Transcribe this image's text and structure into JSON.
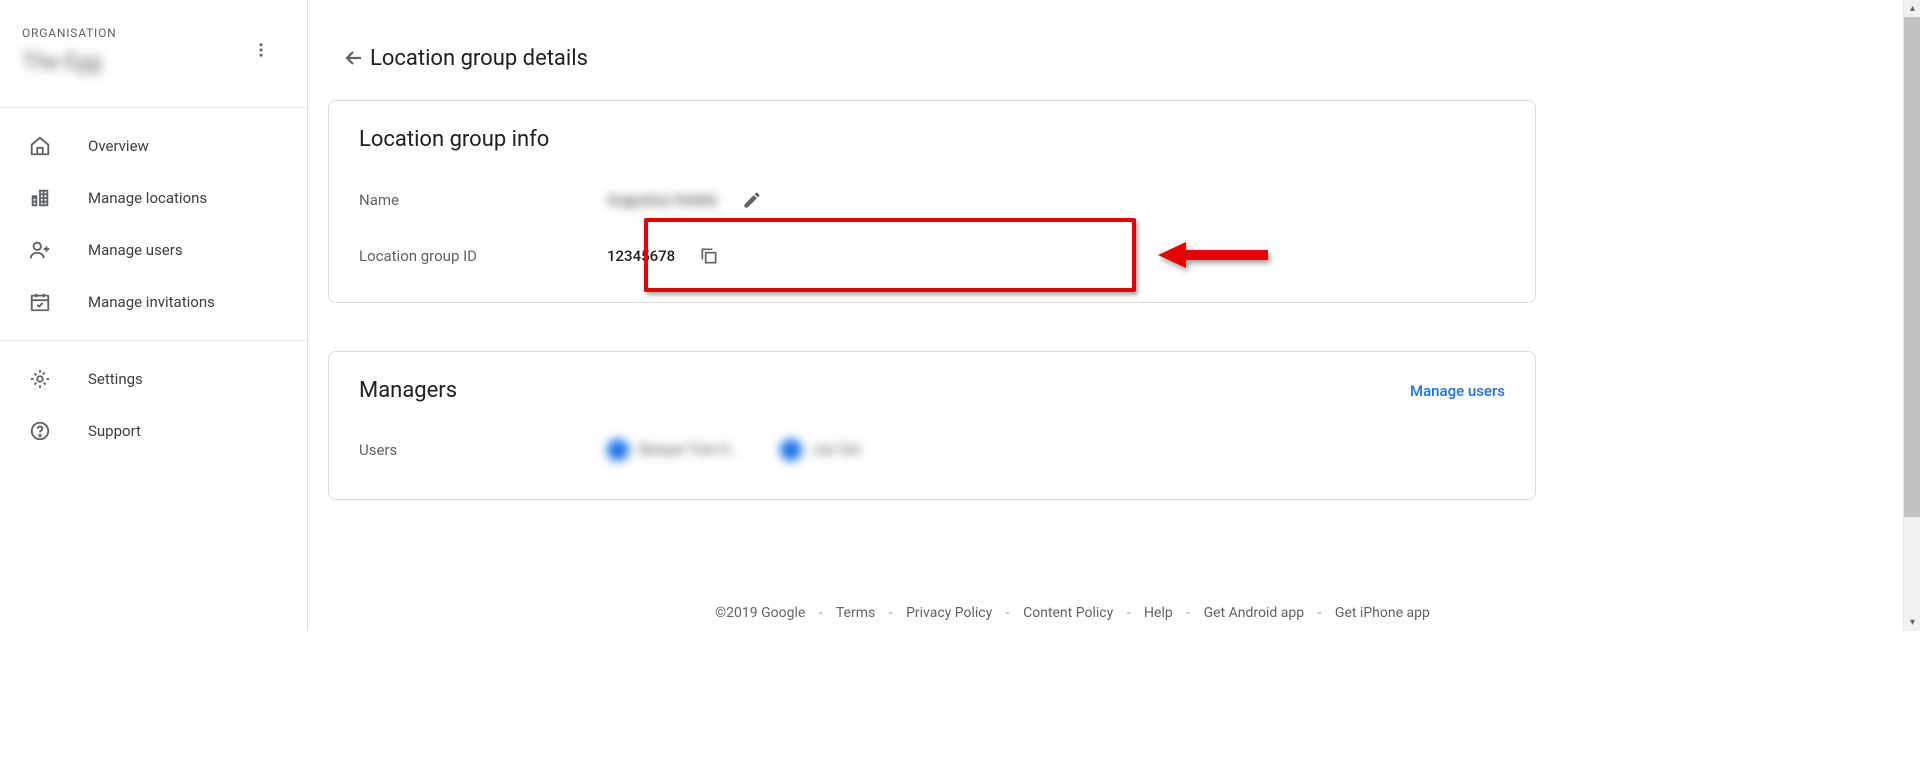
{
  "sidebar": {
    "org_label": "ORGANISATION",
    "org_name": "The Egg",
    "items": [
      {
        "label": "Overview"
      },
      {
        "label": "Manage locations"
      },
      {
        "label": "Manage users"
      },
      {
        "label": "Manage invitations"
      }
    ],
    "settings": {
      "label": "Settings"
    },
    "support": {
      "label": "Support"
    }
  },
  "page": {
    "title": "Location group details"
  },
  "info_card": {
    "title": "Location group info",
    "name_label": "Name",
    "name_value": "Augustus Hotels",
    "id_label": "Location group ID",
    "id_value": "12345678"
  },
  "managers_card": {
    "title": "Managers",
    "manage_link": "Manage users",
    "users_label": "Users",
    "users": [
      {
        "name": "Banyan Tree H..."
      },
      {
        "name": "Joy Tan"
      }
    ]
  },
  "footer": {
    "copyright": "©2019 Google",
    "links": [
      "Terms",
      "Privacy Policy",
      "Content Policy",
      "Help",
      "Get Android app",
      "Get iPhone app"
    ]
  }
}
